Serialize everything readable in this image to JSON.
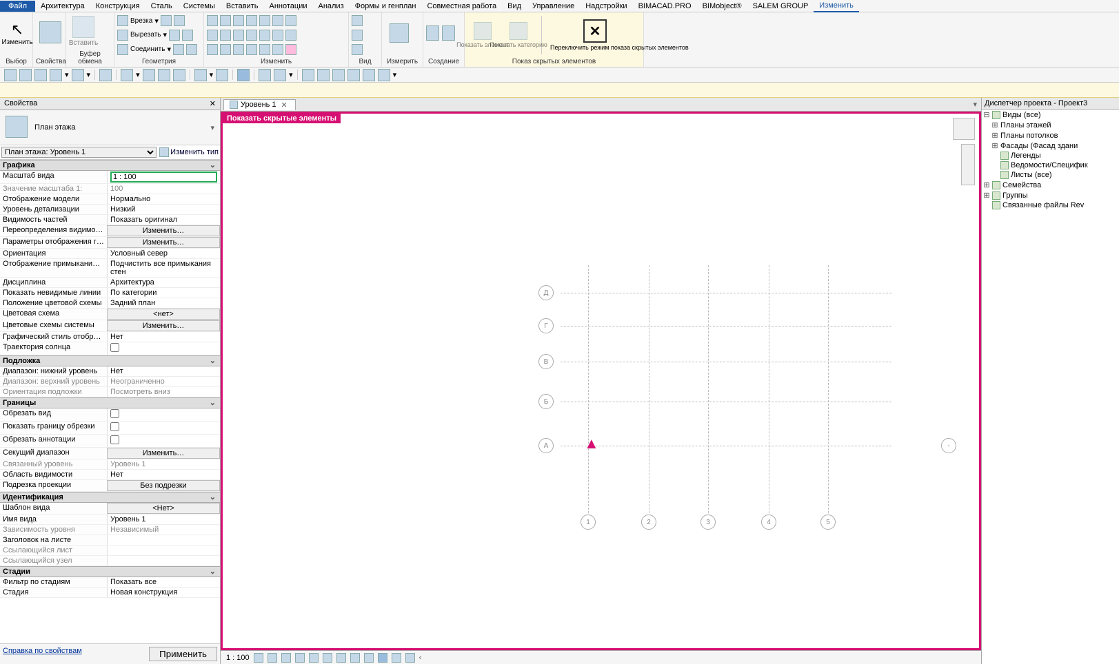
{
  "menu": {
    "file": "Файл",
    "tabs": [
      "Архитектура",
      "Конструкция",
      "Сталь",
      "Системы",
      "Вставить",
      "Аннотации",
      "Анализ",
      "Формы и генплан",
      "Совместная работа",
      "Вид",
      "Управление",
      "Надстройки",
      "BIMACAD.PRO",
      "BIMobject®",
      "SALEM GROUP",
      "Изменить"
    ],
    "active": "Изменить"
  },
  "ribbon": {
    "groups": [
      {
        "label": "Выбор",
        "big": [
          {
            "name": "modify",
            "label": "Изменить"
          }
        ]
      },
      {
        "label": "Свойства",
        "big": [
          {
            "name": "props",
            "label": ""
          }
        ]
      },
      {
        "label": "Буфер обмена",
        "big": [
          {
            "name": "paste",
            "label": "Вставить"
          }
        ]
      },
      {
        "label": "Геометрия",
        "rows": [
          {
            "name": "cut",
            "label": "Врезка"
          },
          {
            "name": "clip",
            "label": "Вырезать"
          },
          {
            "name": "join",
            "label": "Соединить"
          }
        ]
      },
      {
        "label": "Изменить"
      },
      {
        "label": "Вид"
      },
      {
        "label": "Измерить"
      },
      {
        "label": "Создание"
      },
      {
        "label": "Показ скрытых элементов",
        "big": [
          {
            "name": "show-el",
            "label": "Показать элемент"
          },
          {
            "name": "show-cat",
            "label": "Показать категорию"
          }
        ],
        "toggle": {
          "name": "toggle-hidden",
          "label": "Переключить режим показа скрытых элементов"
        }
      }
    ]
  },
  "props": {
    "title": "Свойства",
    "type_name": "План этажа",
    "selector": "План этажа: Уровень 1",
    "edit_type": "Изменить тип",
    "help": "Справка по свойствам",
    "apply": "Применить",
    "cats": [
      {
        "name": "Графика",
        "rows": [
          {
            "k": "Масштаб вида",
            "v": "1 : 100",
            "input": true
          },
          {
            "k": "Значение масштаба    1:",
            "v": "100",
            "dim": true
          },
          {
            "k": "Отображение модели",
            "v": "Нормально"
          },
          {
            "k": "Уровень детализации",
            "v": "Низкий"
          },
          {
            "k": "Видимость частей",
            "v": "Показать оригинал"
          },
          {
            "k": "Переопределения видимости/…",
            "v": "Изменить…",
            "btn": true
          },
          {
            "k": "Параметры отображения граф…",
            "v": "Изменить…",
            "btn": true
          },
          {
            "k": "Ориентация",
            "v": "Условный север"
          },
          {
            "k": "Отображение примыканий стен",
            "v": "Подчистить все примыкания стен"
          },
          {
            "k": "Дисциплина",
            "v": "Архитектура"
          },
          {
            "k": "Показать невидимые линии",
            "v": "По категории"
          },
          {
            "k": "Положение цветовой схемы",
            "v": "Задний план"
          },
          {
            "k": "Цветовая схема",
            "v": "<нет>",
            "btn": true
          },
          {
            "k": "Цветовые схемы системы",
            "v": "Изменить…",
            "btn": true
          },
          {
            "k": "Графический стиль отображе…",
            "v": "Нет"
          },
          {
            "k": "Траектория солнца",
            "v": "",
            "chk": true
          }
        ]
      },
      {
        "name": "Подложка",
        "rows": [
          {
            "k": "Диапазон: нижний уровень",
            "v": "Нет"
          },
          {
            "k": "Диапазон: верхний уровень",
            "v": "Неограниченно",
            "dim": true
          },
          {
            "k": "Ориентация подложки",
            "v": "Посмотреть вниз",
            "dim": true
          }
        ]
      },
      {
        "name": "Границы",
        "rows": [
          {
            "k": "Обрезать вид",
            "v": "",
            "chk": true
          },
          {
            "k": "Показать границу обрезки",
            "v": "",
            "chk": true
          },
          {
            "k": "Обрезать аннотации",
            "v": "",
            "chk": true
          },
          {
            "k": "Секущий диапазон",
            "v": "Изменить…",
            "btn": true
          },
          {
            "k": "Связанный уровень",
            "v": "Уровень 1",
            "dim": true
          },
          {
            "k": "Область видимости",
            "v": "Нет"
          },
          {
            "k": "Подрезка проекции",
            "v": "Без подрезки",
            "btn": true
          }
        ]
      },
      {
        "name": "Идентификация",
        "rows": [
          {
            "k": "Шаблон вида",
            "v": "<Нет>",
            "btn": true
          },
          {
            "k": "Имя вида",
            "v": "Уровень 1"
          },
          {
            "k": "Зависимость уровня",
            "v": "Независимый",
            "dim": true
          },
          {
            "k": "Заголовок на листе",
            "v": ""
          },
          {
            "k": "Ссылающийся лист",
            "v": "",
            "dim": true
          },
          {
            "k": "Ссылающийся узел",
            "v": "",
            "dim": true
          }
        ]
      },
      {
        "name": "Стадии",
        "rows": [
          {
            "k": "Фильтр по стадиям",
            "v": "Показать все"
          },
          {
            "k": "Стадия",
            "v": "Новая конструкция"
          }
        ]
      }
    ]
  },
  "doc": {
    "tab": "Уровень 1",
    "banner": "Показать скрытые элементы"
  },
  "grid": {
    "hlabels": [
      "Д",
      "Г",
      "В",
      "Б",
      "А"
    ],
    "vlabels": [
      "1",
      "2",
      "3",
      "4",
      "5"
    ],
    "extra": "-"
  },
  "status": {
    "scale": "1 : 100"
  },
  "browser": {
    "title": "Диспетчер проекта - Проект3",
    "items": [
      {
        "l": 0,
        "t": "−",
        "label": "Виды (все)",
        "icon": "views"
      },
      {
        "l": 1,
        "t": "+",
        "label": "Планы этажей"
      },
      {
        "l": 1,
        "t": "+",
        "label": "Планы потолков"
      },
      {
        "l": 1,
        "t": "+",
        "label": "Фасады (Фасад здани"
      },
      {
        "l": 1,
        "t": "",
        "label": "Легенды",
        "icon": "legend"
      },
      {
        "l": 1,
        "t": "",
        "label": "Ведомости/Специфик",
        "icon": "sched"
      },
      {
        "l": 1,
        "t": "",
        "label": "Листы (все)",
        "icon": "sheet"
      },
      {
        "l": 0,
        "t": "+",
        "label": "Семейства",
        "icon": "fam"
      },
      {
        "l": 0,
        "t": "+",
        "label": "Группы",
        "icon": "grp"
      },
      {
        "l": 0,
        "t": "",
        "label": "Связанные файлы Rev",
        "icon": "link"
      }
    ]
  }
}
